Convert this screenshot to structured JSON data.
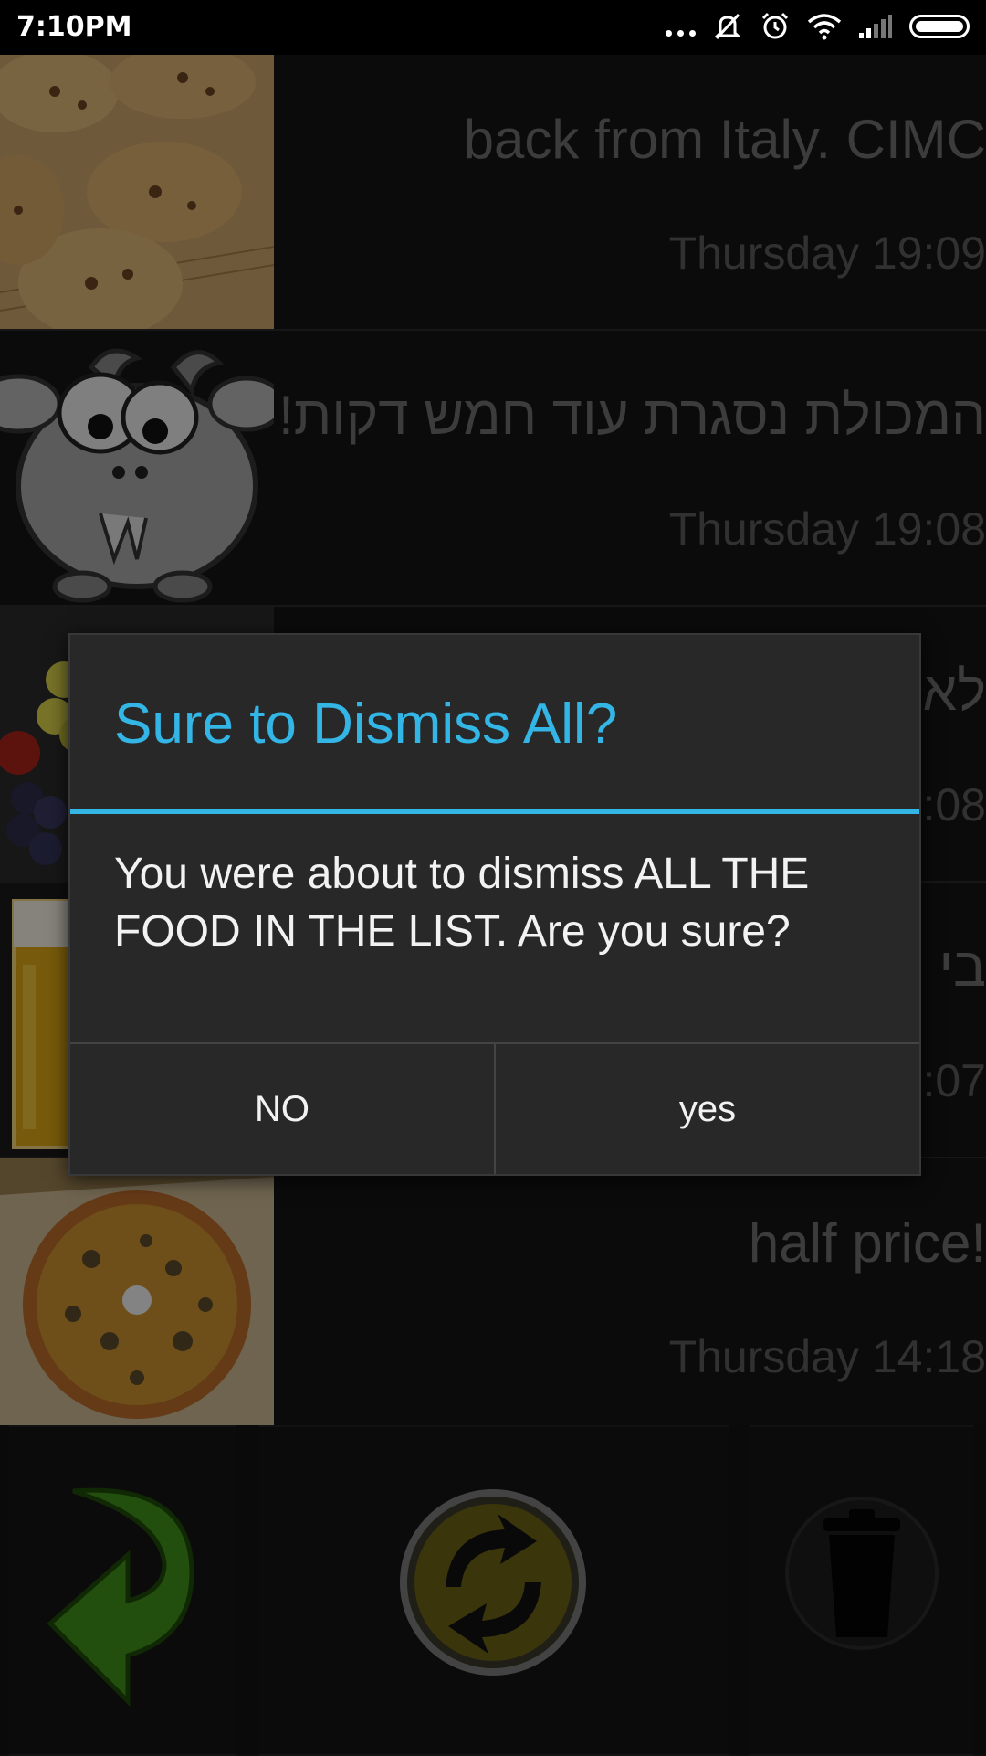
{
  "status_bar": {
    "time": "7:10PM"
  },
  "list": {
    "items": [
      {
        "title": "back from Italy. CIMC",
        "time": "Thursday 19:09",
        "thumb": "cookies"
      },
      {
        "title": "המכולת נסגרת עוד חמש דקות!",
        "time": "Thursday 19:08",
        "thumb": "goat"
      },
      {
        "title": "לא",
        "time": ":08",
        "thumb": "grapes"
      },
      {
        "title": "בי",
        "time": ":07",
        "thumb": "beer"
      },
      {
        "title": "half price!",
        "time": "Thursday 14:18",
        "thumb": "pizza"
      }
    ]
  },
  "dialog": {
    "title": "Sure to Dismiss All?",
    "message": "You were about to dismiss ALL THE FOOD IN THE LIST. Are you sure?",
    "buttons": {
      "no": "NO",
      "yes": "yes"
    }
  },
  "toolbar": {
    "icons": [
      "back-arrow-icon",
      "refresh-icon",
      "trash-icon"
    ]
  },
  "colors": {
    "accent": "#33b5e5",
    "dialog_bg": "#282828",
    "back_arrow": "#3f8f1a",
    "refresh_button": "#6b6115"
  }
}
